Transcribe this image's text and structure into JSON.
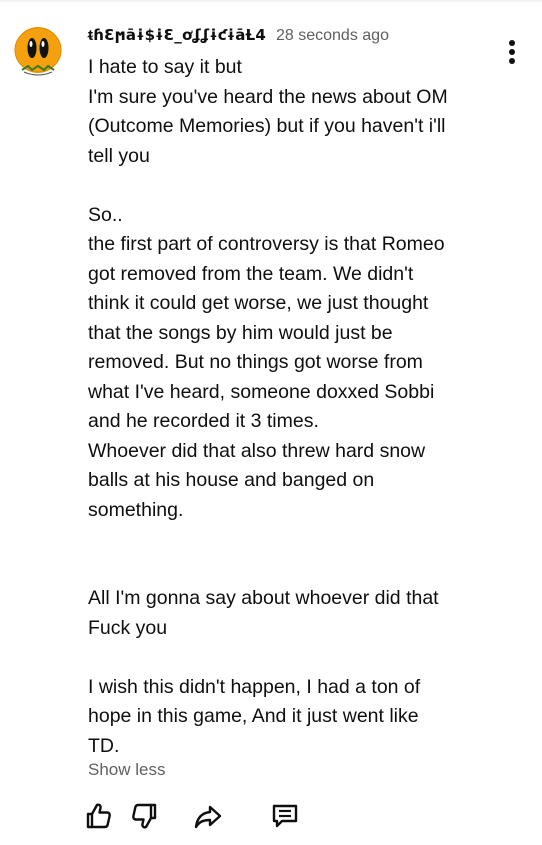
{
  "comment": {
    "author": "ᵵɦƐϻāɨ$ɨƐ_ơʆʆɨƈɨāȽ4",
    "timestamp": "28 seconds ago",
    "text": "I hate to say it but\nI'm sure you've heard the news about OM\n(Outcome Memories) but if you haven't i'll\ntell you\n\nSo..\nthe first part of controversy is that Romeo\ngot removed from the team. We didn't\nthink it could get worse, we just thought\nthat the songs by him would just be\nremoved. But no things got worse from\nwhat I've heard, someone doxxed Sobbi\nand he recorded it 3 times.\nWhoever did that also threw hard snow\nballs at his house and banged on\nsomething.\n\n\nAll I'm gonna say about whoever did that\nFuck you\n\nI wish this didn't happen, I had a ton of\nhope in this game, And it just went like\nTD.",
    "show_less_label": "Show less"
  },
  "actions": {
    "like_icon": "thumbs-up-icon",
    "dislike_icon": "thumbs-down-icon",
    "share_icon": "share-arrow-icon",
    "reply_icon": "reply-comment-icon",
    "more_icon": "vertical-ellipsis-icon"
  },
  "colors": {
    "text_primary": "#0f0f0f",
    "text_secondary": "#606060",
    "avatar_orange": "#f5a00f",
    "background": "#ffffff"
  }
}
